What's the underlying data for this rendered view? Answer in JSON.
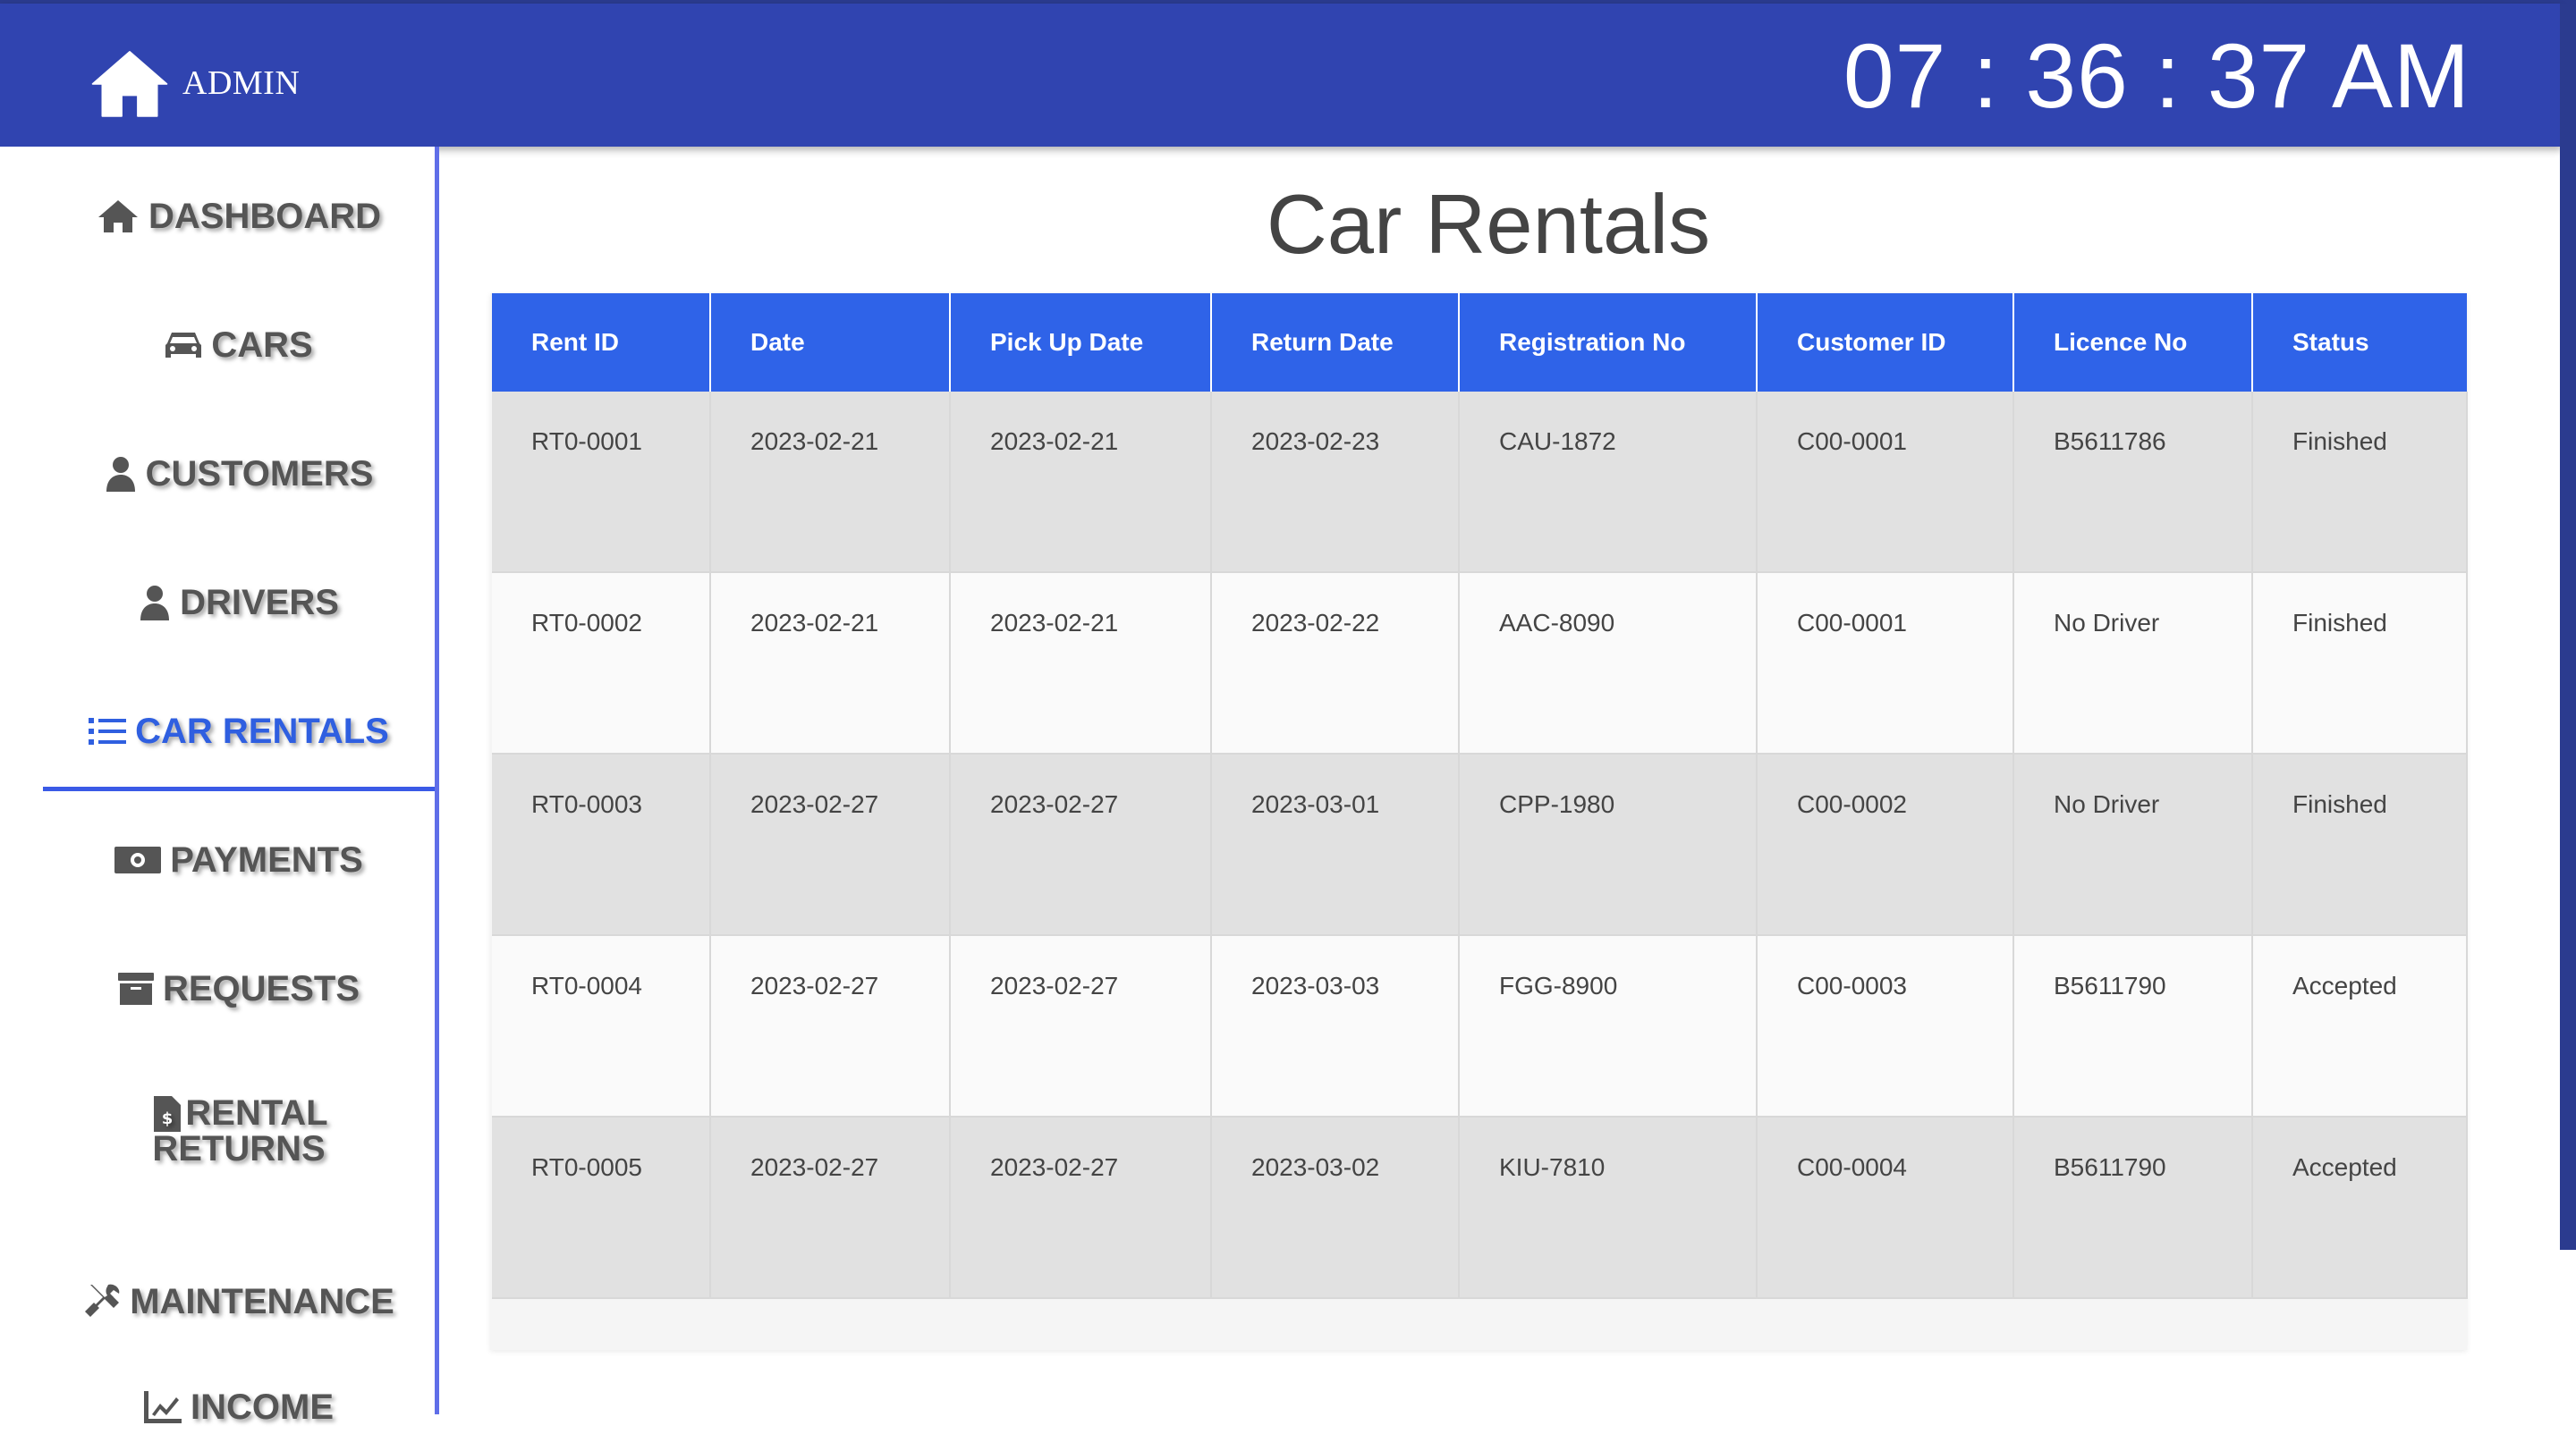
{
  "header": {
    "brand": "ADMIN",
    "clock": "07 : 36 : 37 AM"
  },
  "sidebar": {
    "items": [
      {
        "label": "DASHBOARD",
        "icon": "home-icon"
      },
      {
        "label": "CARS",
        "icon": "car-icon"
      },
      {
        "label": "CUSTOMERS",
        "icon": "user-icon"
      },
      {
        "label": "DRIVERS",
        "icon": "user-icon"
      },
      {
        "label": "CAR RENTALS",
        "icon": "list-icon",
        "active": true
      },
      {
        "label": "PAYMENTS",
        "icon": "money-icon"
      },
      {
        "label": "REQUESTS",
        "icon": "archive-icon"
      },
      {
        "label": "RENTAL",
        "label2": "RETURNS",
        "icon": "invoice-icon"
      },
      {
        "label": "MAINTENANCE",
        "icon": "tools-icon"
      },
      {
        "label": "INCOME",
        "icon": "chart-line-icon"
      }
    ]
  },
  "main": {
    "title": "Car Rentals",
    "table": {
      "columns": [
        "Rent ID",
        "Date",
        "Pick Up Date",
        "Return Date",
        "Registration No",
        "Customer ID",
        "Licence No",
        "Status"
      ],
      "rows": [
        [
          "RT0-0001",
          "2023-02-21",
          "2023-02-21",
          "2023-02-23",
          "CAU-1872",
          "C00-0001",
          "B5611786",
          "Finished"
        ],
        [
          "RT0-0002",
          "2023-02-21",
          "2023-02-21",
          "2023-02-22",
          "AAC-8090",
          "C00-0001",
          "No Driver",
          "Finished"
        ],
        [
          "RT0-0003",
          "2023-02-27",
          "2023-02-27",
          "2023-03-01",
          "CPP-1980",
          "C00-0002",
          "No Driver",
          "Finished"
        ],
        [
          "RT0-0004",
          "2023-02-27",
          "2023-02-27",
          "2023-03-03",
          "FGG-8900",
          "C00-0003",
          "B5611790",
          "Accepted"
        ],
        [
          "RT0-0005",
          "2023-02-27",
          "2023-02-27",
          "2023-03-02",
          "KIU-7810",
          "C00-0004",
          "B5611790",
          "Accepted"
        ]
      ]
    }
  },
  "colors": {
    "header": "#3044b0",
    "accent": "#2f63e8",
    "active": "#2f5fe0"
  }
}
